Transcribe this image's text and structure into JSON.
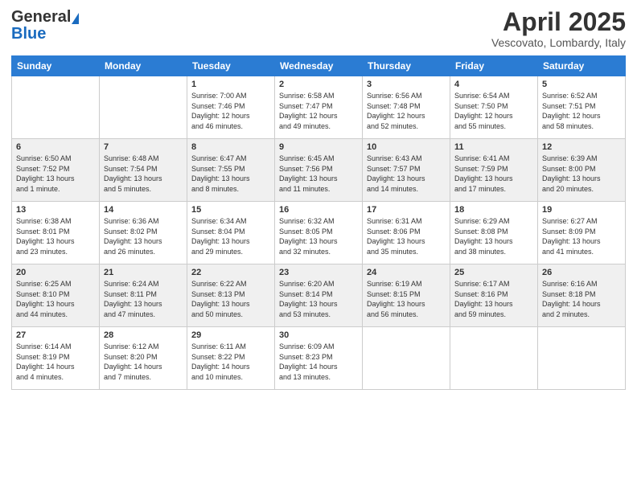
{
  "header": {
    "logo_general": "General",
    "logo_blue": "Blue",
    "month_title": "April 2025",
    "location": "Vescovato, Lombardy, Italy"
  },
  "days_of_week": [
    "Sunday",
    "Monday",
    "Tuesday",
    "Wednesday",
    "Thursday",
    "Friday",
    "Saturday"
  ],
  "weeks": [
    [
      {
        "day": "",
        "info": ""
      },
      {
        "day": "",
        "info": ""
      },
      {
        "day": "1",
        "info": "Sunrise: 7:00 AM\nSunset: 7:46 PM\nDaylight: 12 hours\nand 46 minutes."
      },
      {
        "day": "2",
        "info": "Sunrise: 6:58 AM\nSunset: 7:47 PM\nDaylight: 12 hours\nand 49 minutes."
      },
      {
        "day": "3",
        "info": "Sunrise: 6:56 AM\nSunset: 7:48 PM\nDaylight: 12 hours\nand 52 minutes."
      },
      {
        "day": "4",
        "info": "Sunrise: 6:54 AM\nSunset: 7:50 PM\nDaylight: 12 hours\nand 55 minutes."
      },
      {
        "day": "5",
        "info": "Sunrise: 6:52 AM\nSunset: 7:51 PM\nDaylight: 12 hours\nand 58 minutes."
      }
    ],
    [
      {
        "day": "6",
        "info": "Sunrise: 6:50 AM\nSunset: 7:52 PM\nDaylight: 13 hours\nand 1 minute."
      },
      {
        "day": "7",
        "info": "Sunrise: 6:48 AM\nSunset: 7:54 PM\nDaylight: 13 hours\nand 5 minutes."
      },
      {
        "day": "8",
        "info": "Sunrise: 6:47 AM\nSunset: 7:55 PM\nDaylight: 13 hours\nand 8 minutes."
      },
      {
        "day": "9",
        "info": "Sunrise: 6:45 AM\nSunset: 7:56 PM\nDaylight: 13 hours\nand 11 minutes."
      },
      {
        "day": "10",
        "info": "Sunrise: 6:43 AM\nSunset: 7:57 PM\nDaylight: 13 hours\nand 14 minutes."
      },
      {
        "day": "11",
        "info": "Sunrise: 6:41 AM\nSunset: 7:59 PM\nDaylight: 13 hours\nand 17 minutes."
      },
      {
        "day": "12",
        "info": "Sunrise: 6:39 AM\nSunset: 8:00 PM\nDaylight: 13 hours\nand 20 minutes."
      }
    ],
    [
      {
        "day": "13",
        "info": "Sunrise: 6:38 AM\nSunset: 8:01 PM\nDaylight: 13 hours\nand 23 minutes."
      },
      {
        "day": "14",
        "info": "Sunrise: 6:36 AM\nSunset: 8:02 PM\nDaylight: 13 hours\nand 26 minutes."
      },
      {
        "day": "15",
        "info": "Sunrise: 6:34 AM\nSunset: 8:04 PM\nDaylight: 13 hours\nand 29 minutes."
      },
      {
        "day": "16",
        "info": "Sunrise: 6:32 AM\nSunset: 8:05 PM\nDaylight: 13 hours\nand 32 minutes."
      },
      {
        "day": "17",
        "info": "Sunrise: 6:31 AM\nSunset: 8:06 PM\nDaylight: 13 hours\nand 35 minutes."
      },
      {
        "day": "18",
        "info": "Sunrise: 6:29 AM\nSunset: 8:08 PM\nDaylight: 13 hours\nand 38 minutes."
      },
      {
        "day": "19",
        "info": "Sunrise: 6:27 AM\nSunset: 8:09 PM\nDaylight: 13 hours\nand 41 minutes."
      }
    ],
    [
      {
        "day": "20",
        "info": "Sunrise: 6:25 AM\nSunset: 8:10 PM\nDaylight: 13 hours\nand 44 minutes."
      },
      {
        "day": "21",
        "info": "Sunrise: 6:24 AM\nSunset: 8:11 PM\nDaylight: 13 hours\nand 47 minutes."
      },
      {
        "day": "22",
        "info": "Sunrise: 6:22 AM\nSunset: 8:13 PM\nDaylight: 13 hours\nand 50 minutes."
      },
      {
        "day": "23",
        "info": "Sunrise: 6:20 AM\nSunset: 8:14 PM\nDaylight: 13 hours\nand 53 minutes."
      },
      {
        "day": "24",
        "info": "Sunrise: 6:19 AM\nSunset: 8:15 PM\nDaylight: 13 hours\nand 56 minutes."
      },
      {
        "day": "25",
        "info": "Sunrise: 6:17 AM\nSunset: 8:16 PM\nDaylight: 13 hours\nand 59 minutes."
      },
      {
        "day": "26",
        "info": "Sunrise: 6:16 AM\nSunset: 8:18 PM\nDaylight: 14 hours\nand 2 minutes."
      }
    ],
    [
      {
        "day": "27",
        "info": "Sunrise: 6:14 AM\nSunset: 8:19 PM\nDaylight: 14 hours\nand 4 minutes."
      },
      {
        "day": "28",
        "info": "Sunrise: 6:12 AM\nSunset: 8:20 PM\nDaylight: 14 hours\nand 7 minutes."
      },
      {
        "day": "29",
        "info": "Sunrise: 6:11 AM\nSunset: 8:22 PM\nDaylight: 14 hours\nand 10 minutes."
      },
      {
        "day": "30",
        "info": "Sunrise: 6:09 AM\nSunset: 8:23 PM\nDaylight: 14 hours\nand 13 minutes."
      },
      {
        "day": "",
        "info": ""
      },
      {
        "day": "",
        "info": ""
      },
      {
        "day": "",
        "info": ""
      }
    ]
  ]
}
